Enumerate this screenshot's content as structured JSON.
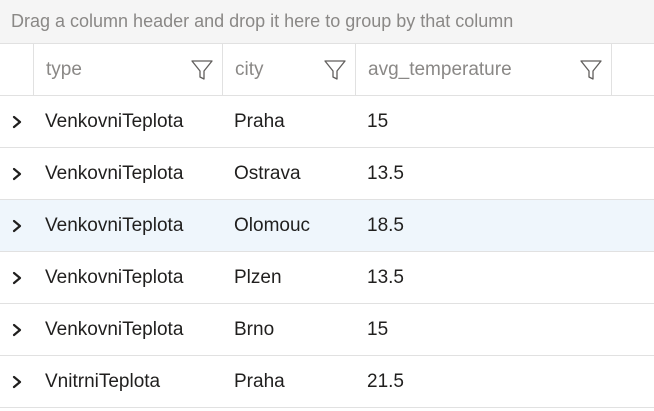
{
  "group_panel": {
    "hint": "Drag a column header and drop it here to group by that column"
  },
  "columns": [
    {
      "label": "type",
      "filter_icon": "filter-icon"
    },
    {
      "label": "city",
      "filter_icon": "filter-icon"
    },
    {
      "label": "avg_temperature",
      "filter_icon": "filter-icon"
    }
  ],
  "rows": [
    {
      "type": "VenkovniTeplota",
      "city": "Praha",
      "avg_temperature": "15"
    },
    {
      "type": "VenkovniTeplota",
      "city": "Ostrava",
      "avg_temperature": "13.5"
    },
    {
      "type": "VenkovniTeplota",
      "city": "Olomouc",
      "avg_temperature": "18.5"
    },
    {
      "type": "VenkovniTeplota",
      "city": "Plzen",
      "avg_temperature": "13.5"
    },
    {
      "type": "VenkovniTeplota",
      "city": "Brno",
      "avg_temperature": "15"
    },
    {
      "type": "VnitrniTeplota",
      "city": "Praha",
      "avg_temperature": "21.5"
    }
  ],
  "selected_row_index": 2,
  "icons": {
    "row_expander": "chevron-right-icon"
  },
  "colors": {
    "selected_row": "#eff6fc",
    "border": "#e1e1e1",
    "header_text": "#8a8886",
    "cell_text": "#201f1e"
  }
}
